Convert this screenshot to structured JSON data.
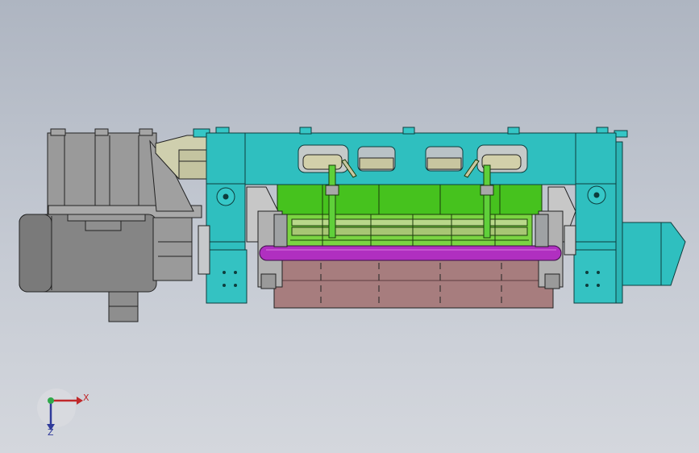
{
  "triad": {
    "x_label": "X",
    "z_label": "Z",
    "x_color": "#c0282a",
    "y_color": "#2fa84a",
    "z_color": "#2f3a9a"
  },
  "colors": {
    "background_top": "#aeb5c1",
    "background_bottom": "#d4d7dd",
    "frame": "#2fbfbf",
    "roller": "#b02fc0",
    "bed": "#a77d7e",
    "knife_holder": "#3fbf1f",
    "motor": "#8c8c8c",
    "gearbox": "#c8c8a8"
  }
}
